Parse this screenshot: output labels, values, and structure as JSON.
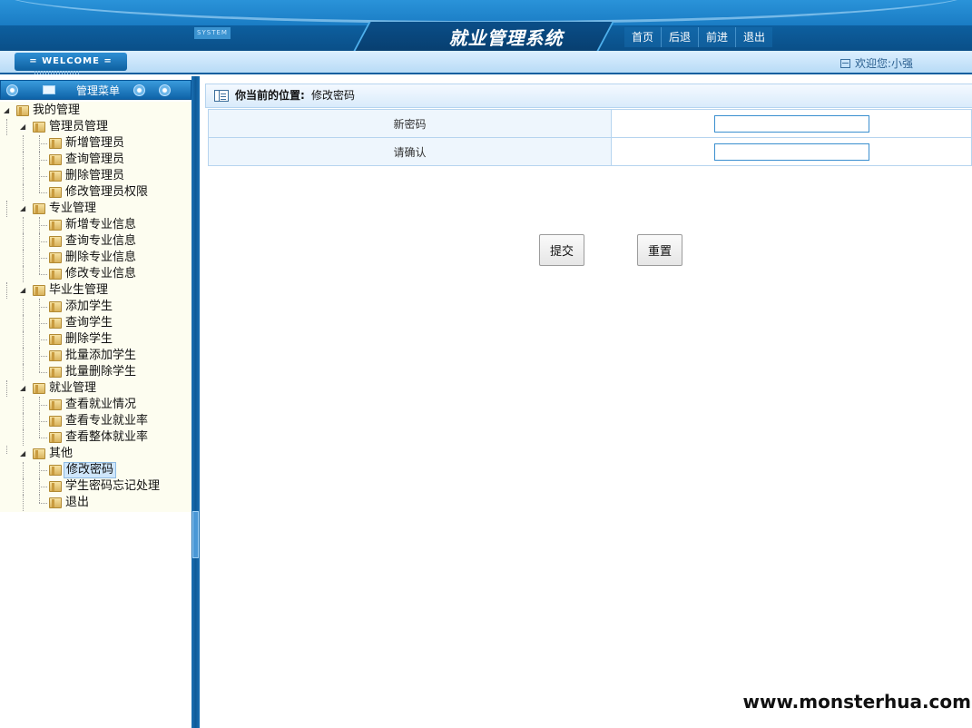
{
  "header": {
    "system_tag": "SYSTEM",
    "title": "就业管理系统",
    "nav": [
      {
        "id": "home",
        "label": "首页"
      },
      {
        "id": "back",
        "label": "后退"
      },
      {
        "id": "forward",
        "label": "前进"
      },
      {
        "id": "logout",
        "label": "退出"
      }
    ]
  },
  "subbar": {
    "welcome": "= WELCOME =",
    "greeting": "欢迎您:小强"
  },
  "sidebar": {
    "title": "管理菜单",
    "root": "我的管理",
    "groups": [
      {
        "label": "管理员管理",
        "items": [
          "新增管理员",
          "查询管理员",
          "删除管理员",
          "修改管理员权限"
        ]
      },
      {
        "label": "专业管理",
        "items": [
          "新增专业信息",
          "查询专业信息",
          "删除专业信息",
          "修改专业信息"
        ]
      },
      {
        "label": "毕业生管理",
        "items": [
          "添加学生",
          "查询学生",
          "删除学生",
          "批量添加学生",
          "批量删除学生"
        ]
      },
      {
        "label": "就业管理",
        "items": [
          "查看就业情况",
          "查看专业就业率",
          "查看整体就业率"
        ]
      },
      {
        "label": "其他",
        "items": [
          "修改密码",
          "学生密码忘记处理",
          "退出"
        ]
      }
    ],
    "selected": "修改密码"
  },
  "main": {
    "location_label": "你当前的位置:",
    "location_value": "修改密码",
    "form": {
      "new_password_label": "新密码",
      "new_password_value": "",
      "confirm_label": "请确认",
      "confirm_value": ""
    },
    "submit_label": "提交",
    "reset_label": "重置"
  },
  "watermark": "www.monsterhua.com",
  "colors": {
    "brand_blue": "#0f6fb8",
    "tree_bg": "#fdfdf0",
    "table_border": "#b6d4ef"
  }
}
